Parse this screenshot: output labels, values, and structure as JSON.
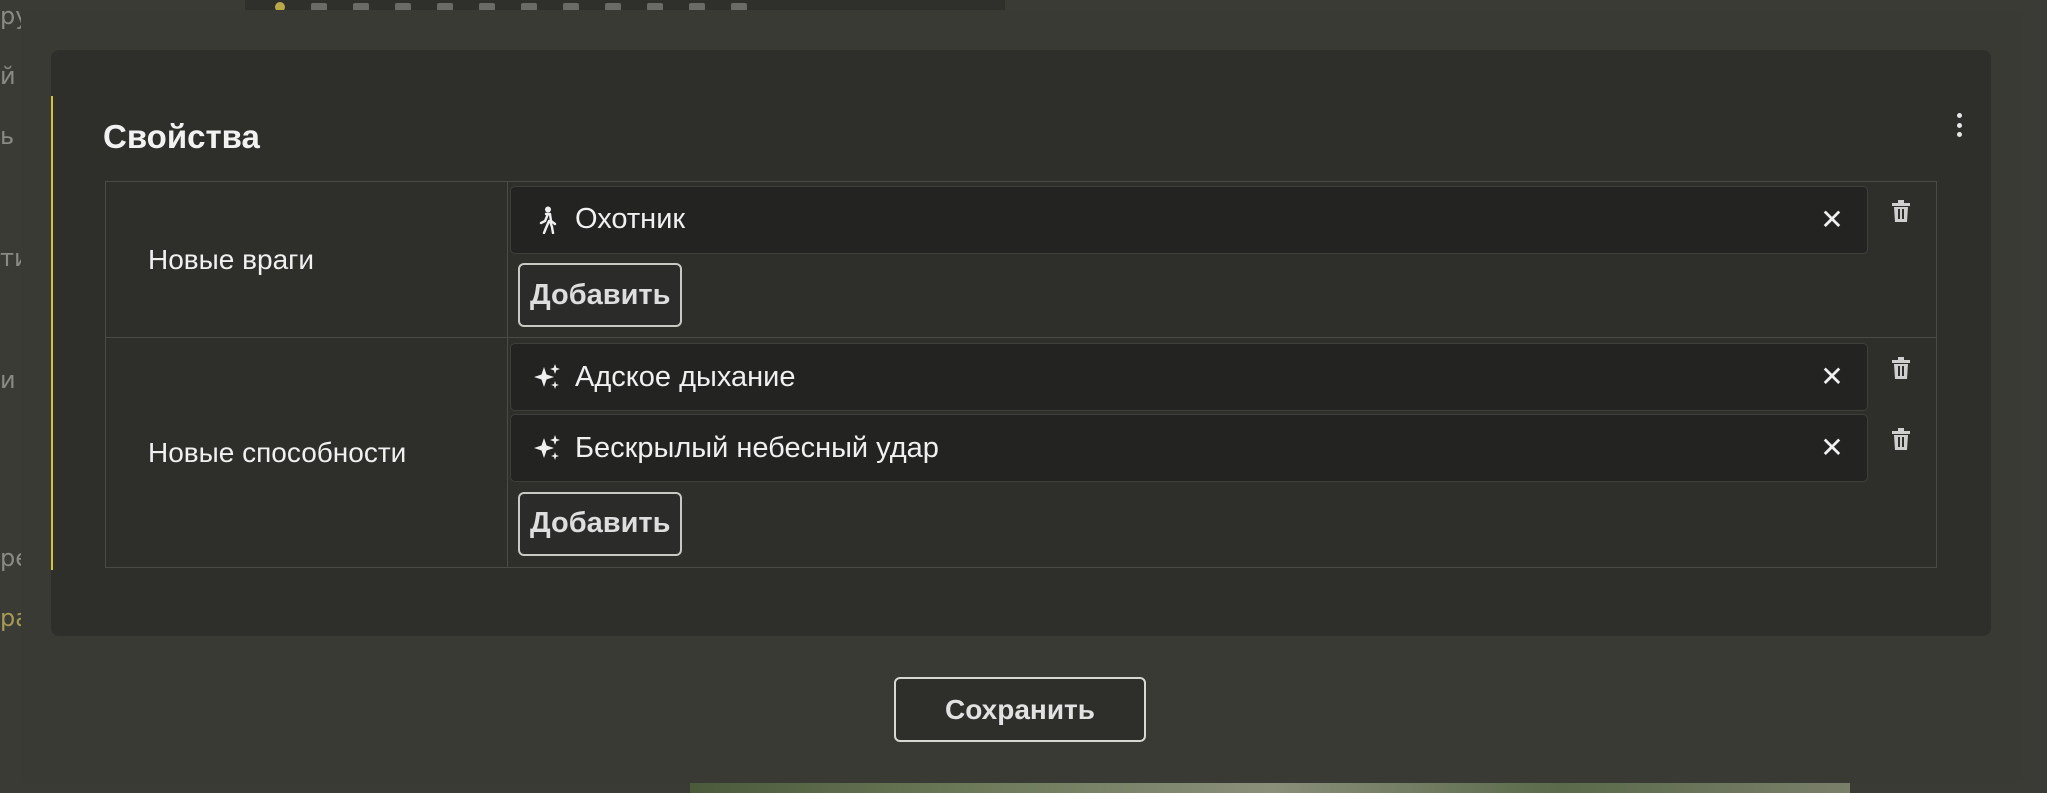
{
  "background": {
    "left_fragments": [
      "ру",
      "й",
      "ь",
      "ти",
      "и",
      "ре",
      "ра"
    ]
  },
  "panel": {
    "title": "Свойства",
    "menu_icon": "more-vertical-icon",
    "accent_color": "#d8c23a"
  },
  "properties": [
    {
      "label": "Новые враги",
      "items": [
        {
          "text": "Охотник",
          "icon": "walking-person-icon"
        }
      ],
      "add_label": "Добавить"
    },
    {
      "label": "Новые способности",
      "items": [
        {
          "text": "Адское дыхание",
          "icon": "sparkles-icon"
        },
        {
          "text": "Бескрылый небесный удар",
          "icon": "sparkles-icon"
        }
      ],
      "add_label": "Добавить"
    }
  ],
  "footer": {
    "save_label": "Сохранить"
  },
  "icons": {
    "remove": "close-icon",
    "delete": "trash-icon"
  }
}
